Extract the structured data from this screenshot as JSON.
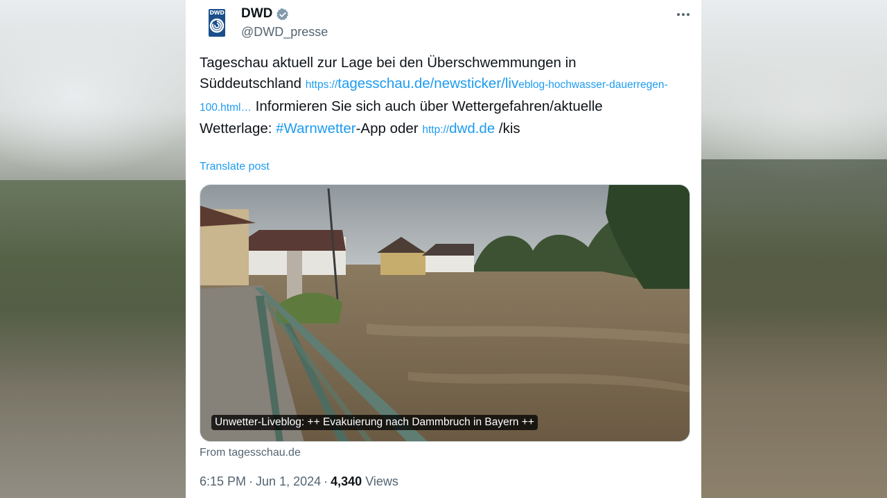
{
  "author": {
    "name": "DWD",
    "handle": "@DWD_presse",
    "avatar_text": "DWD",
    "verified_icon": "verified-badge-icon"
  },
  "tweet": {
    "text_1": "Tageschau aktuell zur Lage bei den Überschwemmungen in Süddeutschland ",
    "link_1_scheme": "https://",
    "link_1_main": "tagesschau.de/newsticker/liv",
    "link_1_rest": "eblog-hochwasser-dauerregen-100.html…",
    "text_2": " Informieren Sie sich auch über Wettergefahren/aktuelle Wetterlage: ",
    "hashtag": "#Warnwetter",
    "text_3": "-App oder ",
    "link_2_scheme": "http://",
    "link_2_main": "dwd.de",
    "text_4": " /kis",
    "translate_label": "Translate post"
  },
  "media": {
    "caption": "Unwetter-Liveblog: ++ Evakuierung nach Dammbruch in Bayern ++",
    "source": "From tagesschau.de"
  },
  "meta": {
    "time": "6:15 PM",
    "separator": "·",
    "date": "Jun 1, 2024",
    "views_count": "4,340",
    "views_label": "Views"
  },
  "colors": {
    "link": "#1d9bf0",
    "text": "#0f1419",
    "secondary": "#536471",
    "avatar_bg": "#1a4f8b"
  },
  "icons": {
    "more": "more-dots-icon",
    "verified": "verified-badge-icon"
  }
}
